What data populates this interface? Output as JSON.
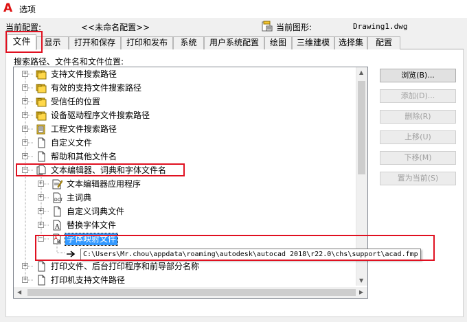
{
  "window": {
    "title": "选项",
    "logo": "A"
  },
  "profile": {
    "label": "当前配置:",
    "value": "<<未命名配置>>"
  },
  "drawing": {
    "label": "当前图形:",
    "value": "Drawing1.dwg",
    "icon": "drawing-file-icon"
  },
  "tabs": [
    "文件",
    "显示",
    "打开和保存",
    "打印和发布",
    "系统",
    "用户系统配置",
    "绘图",
    "三维建模",
    "选择集",
    "配置"
  ],
  "active_tab": "文件",
  "tree_caption": "搜索路径、文件名和文件位置:",
  "tree": {
    "items": [
      {
        "label": "支持文件搜索路径",
        "icon": "folder-stack-icon",
        "expanded": false
      },
      {
        "label": "有效的支持文件搜索路径",
        "icon": "folder-stack-icon",
        "expanded": false
      },
      {
        "label": "受信任的位置",
        "icon": "folder-stack-icon",
        "expanded": false
      },
      {
        "label": "设备驱动程序文件搜索路径",
        "icon": "folder-stack-icon",
        "expanded": false
      },
      {
        "label": "工程文件搜索路径",
        "icon": "project-folder-icon",
        "expanded": false
      },
      {
        "label": "自定义文件",
        "icon": "document-icon",
        "expanded": false
      },
      {
        "label": "帮助和其他文件名",
        "icon": "document-icon",
        "expanded": false
      },
      {
        "label": "文本编辑器、词典和字体文件名",
        "icon": "document-stack-icon",
        "expanded": true
      },
      {
        "label": "文本编辑器应用程序",
        "icon": "text-editor-icon",
        "expanded": false
      },
      {
        "label": "主词典",
        "icon": "dictionary-icon",
        "expanded": false
      },
      {
        "label": "自定义词典文件",
        "icon": "document-icon",
        "expanded": false
      },
      {
        "label": "替换字体文件",
        "icon": "font-file-icon",
        "expanded": false
      },
      {
        "label": "字体映射文件",
        "icon": "font-map-icon",
        "expanded": true,
        "selected": true
      },
      {
        "label": "打印文件、后台打印程序和前导部分名称",
        "icon": "document-icon",
        "expanded": false
      },
      {
        "label": "打印机支持文件路径",
        "icon": "document-icon",
        "expanded": false
      }
    ],
    "tooltip_path": "C:\\Users\\Mr.chou\\appdata\\roaming\\autodesk\\autocad 2018\\r22.0\\chs\\support\\acad.fmp"
  },
  "buttons": [
    {
      "label": "浏览(B)...",
      "enabled": true
    },
    {
      "label": "添加(D)...",
      "enabled": false
    },
    {
      "label": "删除(R)",
      "enabled": false
    },
    {
      "label": "上移(U)",
      "enabled": false
    },
    {
      "label": "下移(M)",
      "enabled": false
    },
    {
      "label": "置为当前(S)",
      "enabled": false
    }
  ],
  "colors": {
    "selection": "#3399ff",
    "highlight_box": "#e01020",
    "logo": "#dd1111"
  }
}
